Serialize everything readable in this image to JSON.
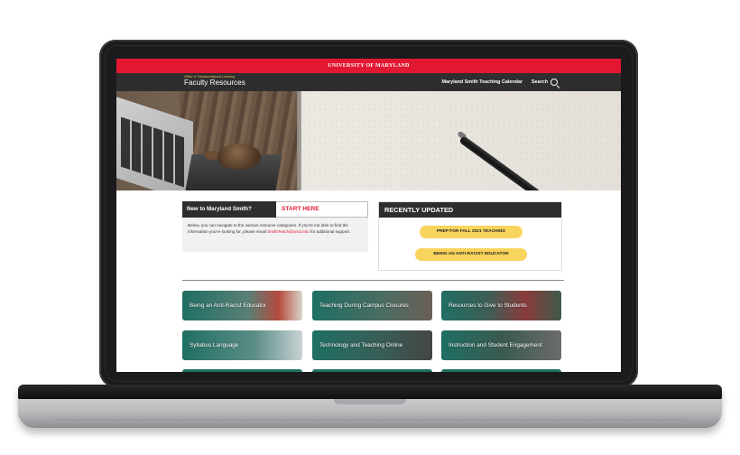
{
  "site": {
    "university": "UNIVERSITY OF MARYLAND",
    "office": "Office of Transformational Learning",
    "title": "Faculty Resources"
  },
  "nav": {
    "calendar": "Maryland Smith Teaching Calendar",
    "search": "Search",
    "search_icon": "search-icon"
  },
  "intro": {
    "new_label": "New to Maryland Smith?",
    "start_label": "START HERE",
    "text_before": "Below, you can navigate to the various resource categories. If you're not able to find the information you're looking for, please email",
    "email": "SmithTeach@umd.edu",
    "text_after": "for additional support."
  },
  "recent": {
    "heading": "RECENTLY UPDATED",
    "items": [
      "PREP FOR FALL 2021 TEACHING",
      "BEING AN ANTI-RACIST EDUCATOR"
    ]
  },
  "categories": [
    "Being an Anti-Racist Educator",
    "Teaching During Campus Closures",
    "Resources to Give to Students",
    "Syllabus Language",
    "Technology and Teaching Online",
    "Instruction and Student Engagement"
  ],
  "colors": {
    "umd_red": "#e21833",
    "nav_dark": "#2e2e2e",
    "pill_yellow": "#f8d45c",
    "tile_teal": "#1f6f64"
  }
}
